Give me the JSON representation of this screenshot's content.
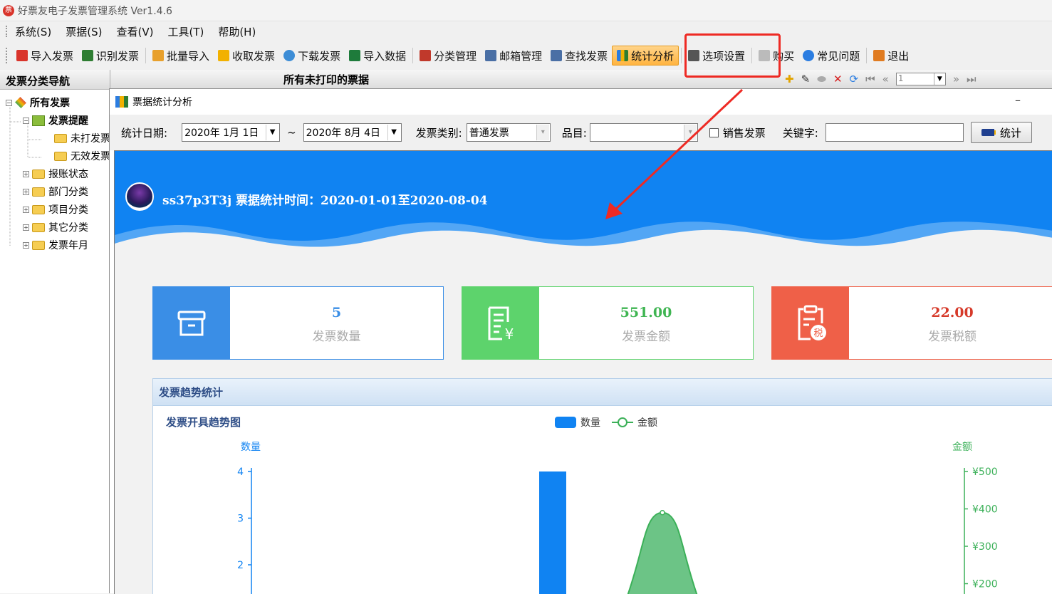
{
  "window": {
    "title": "好票友电子发票管理系统 Ver1.4.6"
  },
  "menu": [
    "系统(S)",
    "票据(S)",
    "查看(V)",
    "工具(T)",
    "帮助(H)"
  ],
  "toolbar": {
    "buttons": [
      {
        "label": "导入发票",
        "icon": "import-invoice-icon",
        "color": "#d9342b"
      },
      {
        "label": "识别发票",
        "icon": "recognize-icon",
        "color": "#2e7d32"
      },
      {
        "label": "批量导入",
        "icon": "batch-import-icon",
        "color": "#e8a02c"
      },
      {
        "label": "收取发票",
        "icon": "receive-icon",
        "color": "#f2b100"
      },
      {
        "label": "下载发票",
        "icon": "download-icon",
        "color": "#3d8dd6"
      },
      {
        "label": "导入数据",
        "icon": "excel-icon",
        "color": "#1e7b3b"
      },
      {
        "label": "分类管理",
        "icon": "category-icon",
        "color": "#c0392b"
      },
      {
        "label": "邮箱管理",
        "icon": "mailbox-icon",
        "color": "#4a6fa5"
      },
      {
        "label": "查找发票",
        "icon": "find-icon",
        "color": "#4a6fa5"
      },
      {
        "label": "统计分析",
        "icon": "bar-chart-icon",
        "color": "#2b7de1"
      },
      {
        "label": "选项设置",
        "icon": "settings-icon",
        "color": "#555555"
      },
      {
        "label": "购买",
        "icon": "cart-icon",
        "color": "#999999"
      },
      {
        "label": "常见问题",
        "icon": "help-icon",
        "color": "#2b7de1"
      },
      {
        "label": "退出",
        "icon": "exit-icon",
        "color": "#e07b20"
      }
    ]
  },
  "leftnav": {
    "title": "发票分类导航",
    "tree": [
      {
        "label": "所有发票",
        "level": 0,
        "box": "−",
        "bold": true
      },
      {
        "label": "发票提醒",
        "level": 1,
        "box": "−",
        "bold": true
      },
      {
        "label": "未打发票",
        "level": 2,
        "box": ""
      },
      {
        "label": "无效发票",
        "level": 2,
        "box": ""
      },
      {
        "label": "报账状态",
        "level": 1,
        "box": "+"
      },
      {
        "label": "部门分类",
        "level": 1,
        "box": "+"
      },
      {
        "label": "项目分类",
        "level": 1,
        "box": "+"
      },
      {
        "label": "其它分类",
        "level": 1,
        "box": "+"
      },
      {
        "label": "发票年月",
        "level": 1,
        "box": "+"
      }
    ]
  },
  "main": {
    "title": "所有未打印的票据",
    "page_value": "1"
  },
  "dialog": {
    "title": "票据统计分析",
    "minimize": "–",
    "filter": {
      "date_label": "统计日期:",
      "date_from": "2020年 1月 1日",
      "tilde": "~",
      "date_to": "2020年 8月 4日",
      "type_label": "发票类别:",
      "type_value": "普通发票",
      "item_label": "品目:",
      "item_value": "",
      "sales_label": "销售发票",
      "keyword_label": "关键字:",
      "keyword_value": "",
      "stat_button": "统计"
    },
    "banner": {
      "text": "ss37p3T3j  票据统计时间：2020-01-01至2020-08-04"
    },
    "cards": [
      {
        "value": "5",
        "label": "发票数量",
        "color": "#3a8ee6",
        "icon": "box-icon"
      },
      {
        "value": "551.00",
        "label": "发票金额",
        "color": "#5dd36c",
        "icon": "invoice-amount-icon"
      },
      {
        "value": "22.00",
        "label": "发票税额",
        "color": "#ef6048",
        "icon": "tax-icon"
      }
    ],
    "trend": {
      "header": "发票趋势统计",
      "chart_title": "发票开具趋势图"
    }
  },
  "chart_data": {
    "type": "bar",
    "title": "发票开具趋势图",
    "legend": [
      "数量",
      "金额"
    ],
    "legend_position": "top-center",
    "y_left": {
      "label": "数量",
      "ticks": [
        2,
        3,
        4
      ]
    },
    "y_right": {
      "label": "金额",
      "ticks": [
        "¥200",
        "¥300",
        "¥400",
        "¥500"
      ]
    },
    "series": [
      {
        "name": "数量",
        "kind": "bar",
        "color": "#1083f2",
        "visible_values": [
          4
        ]
      },
      {
        "name": "金额",
        "kind": "area",
        "color": "#3bb058",
        "visible_peak": 390
      }
    ]
  }
}
